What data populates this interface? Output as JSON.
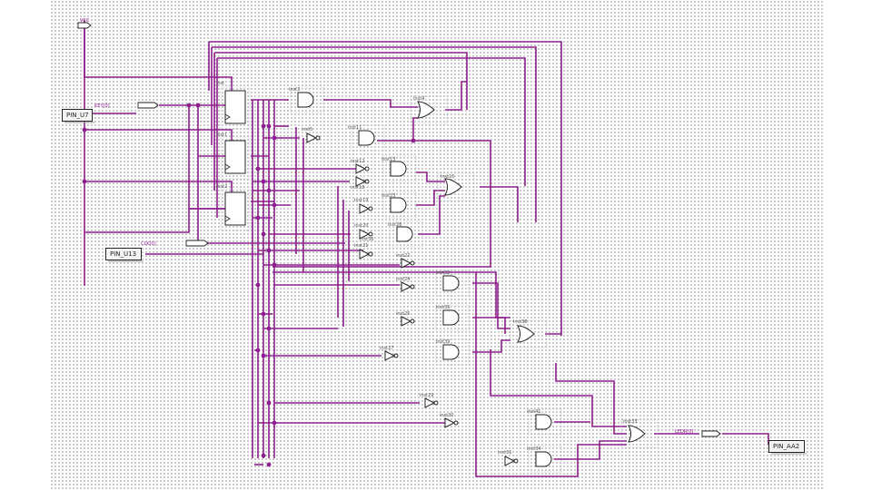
{
  "pins": {
    "top_pin": "PIN_U7",
    "clk_pin": "PIN_U13",
    "out_pin": "PIN_AA2"
  },
  "nets": {
    "vcc": "VCC",
    "key": "KEY[0]",
    "clk": "CLK[0]",
    "led": "LEDR[0]"
  },
  "instances": {
    "dff": [
      "inst",
      "inst1",
      "inst2"
    ],
    "and": [
      "inst3",
      "inst11",
      "inst13",
      "inst23",
      "inst26",
      "inst32",
      "inst35",
      "inst39",
      "inst41",
      "inst34"
    ],
    "or": [
      "inst4",
      "inst15",
      "inst38",
      "inst33"
    ],
    "not": [
      "inst5",
      "inst12",
      "inst18",
      "inst19",
      "inst20",
      "inst21",
      "inst22",
      "inst24",
      "inst25",
      "inst27",
      "inst29",
      "inst30",
      "inst31",
      "inst36"
    ]
  },
  "colors": {
    "wire": "#8e1f8e",
    "grid": "#9a9a9a",
    "symbol": "#222222"
  }
}
